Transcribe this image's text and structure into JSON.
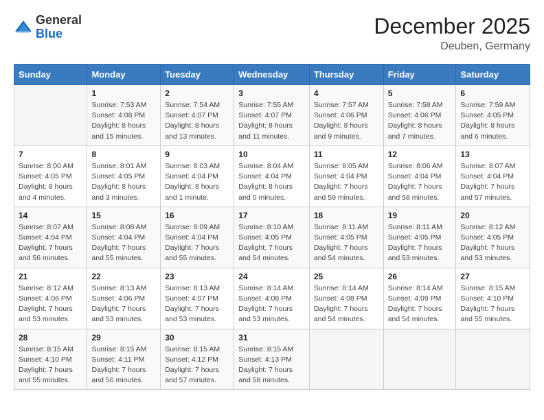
{
  "header": {
    "logo_general": "General",
    "logo_blue": "Blue",
    "month_title": "December 2025",
    "location": "Deuben, Germany"
  },
  "weekdays": [
    "Sunday",
    "Monday",
    "Tuesday",
    "Wednesday",
    "Thursday",
    "Friday",
    "Saturday"
  ],
  "weeks": [
    [
      {
        "day": "",
        "info": ""
      },
      {
        "day": "1",
        "info": "Sunrise: 7:53 AM\nSunset: 4:08 PM\nDaylight: 8 hours\nand 15 minutes."
      },
      {
        "day": "2",
        "info": "Sunrise: 7:54 AM\nSunset: 4:07 PM\nDaylight: 8 hours\nand 13 minutes."
      },
      {
        "day": "3",
        "info": "Sunrise: 7:55 AM\nSunset: 4:07 PM\nDaylight: 8 hours\nand 11 minutes."
      },
      {
        "day": "4",
        "info": "Sunrise: 7:57 AM\nSunset: 4:06 PM\nDaylight: 8 hours\nand 9 minutes."
      },
      {
        "day": "5",
        "info": "Sunrise: 7:58 AM\nSunset: 4:06 PM\nDaylight: 8 hours\nand 7 minutes."
      },
      {
        "day": "6",
        "info": "Sunrise: 7:59 AM\nSunset: 4:05 PM\nDaylight: 8 hours\nand 6 minutes."
      }
    ],
    [
      {
        "day": "7",
        "info": "Sunrise: 8:00 AM\nSunset: 4:05 PM\nDaylight: 8 hours\nand 4 minutes."
      },
      {
        "day": "8",
        "info": "Sunrise: 8:01 AM\nSunset: 4:05 PM\nDaylight: 8 hours\nand 3 minutes."
      },
      {
        "day": "9",
        "info": "Sunrise: 8:03 AM\nSunset: 4:04 PM\nDaylight: 8 hours\nand 1 minute."
      },
      {
        "day": "10",
        "info": "Sunrise: 8:04 AM\nSunset: 4:04 PM\nDaylight: 8 hours\nand 0 minutes."
      },
      {
        "day": "11",
        "info": "Sunrise: 8:05 AM\nSunset: 4:04 PM\nDaylight: 7 hours\nand 59 minutes."
      },
      {
        "day": "12",
        "info": "Sunrise: 8:06 AM\nSunset: 4:04 PM\nDaylight: 7 hours\nand 58 minutes."
      },
      {
        "day": "13",
        "info": "Sunrise: 8:07 AM\nSunset: 4:04 PM\nDaylight: 7 hours\nand 57 minutes."
      }
    ],
    [
      {
        "day": "14",
        "info": "Sunrise: 8:07 AM\nSunset: 4:04 PM\nDaylight: 7 hours\nand 56 minutes."
      },
      {
        "day": "15",
        "info": "Sunrise: 8:08 AM\nSunset: 4:04 PM\nDaylight: 7 hours\nand 55 minutes."
      },
      {
        "day": "16",
        "info": "Sunrise: 8:09 AM\nSunset: 4:04 PM\nDaylight: 7 hours\nand 55 minutes."
      },
      {
        "day": "17",
        "info": "Sunrise: 8:10 AM\nSunset: 4:05 PM\nDaylight: 7 hours\nand 54 minutes."
      },
      {
        "day": "18",
        "info": "Sunrise: 8:11 AM\nSunset: 4:05 PM\nDaylight: 7 hours\nand 54 minutes."
      },
      {
        "day": "19",
        "info": "Sunrise: 8:11 AM\nSunset: 4:05 PM\nDaylight: 7 hours\nand 53 minutes."
      },
      {
        "day": "20",
        "info": "Sunrise: 8:12 AM\nSunset: 4:05 PM\nDaylight: 7 hours\nand 53 minutes."
      }
    ],
    [
      {
        "day": "21",
        "info": "Sunrise: 8:12 AM\nSunset: 4:06 PM\nDaylight: 7 hours\nand 53 minutes."
      },
      {
        "day": "22",
        "info": "Sunrise: 8:13 AM\nSunset: 4:06 PM\nDaylight: 7 hours\nand 53 minutes."
      },
      {
        "day": "23",
        "info": "Sunrise: 8:13 AM\nSunset: 4:07 PM\nDaylight: 7 hours\nand 53 minutes."
      },
      {
        "day": "24",
        "info": "Sunrise: 8:14 AM\nSunset: 4:08 PM\nDaylight: 7 hours\nand 53 minutes."
      },
      {
        "day": "25",
        "info": "Sunrise: 8:14 AM\nSunset: 4:08 PM\nDaylight: 7 hours\nand 54 minutes."
      },
      {
        "day": "26",
        "info": "Sunrise: 8:14 AM\nSunset: 4:09 PM\nDaylight: 7 hours\nand 54 minutes."
      },
      {
        "day": "27",
        "info": "Sunrise: 8:15 AM\nSunset: 4:10 PM\nDaylight: 7 hours\nand 55 minutes."
      }
    ],
    [
      {
        "day": "28",
        "info": "Sunrise: 8:15 AM\nSunset: 4:10 PM\nDaylight: 7 hours\nand 55 minutes."
      },
      {
        "day": "29",
        "info": "Sunrise: 8:15 AM\nSunset: 4:11 PM\nDaylight: 7 hours\nand 56 minutes."
      },
      {
        "day": "30",
        "info": "Sunrise: 8:15 AM\nSunset: 4:12 PM\nDaylight: 7 hours\nand 57 minutes."
      },
      {
        "day": "31",
        "info": "Sunrise: 8:15 AM\nSunset: 4:13 PM\nDaylight: 7 hours\nand 58 minutes."
      },
      {
        "day": "",
        "info": ""
      },
      {
        "day": "",
        "info": ""
      },
      {
        "day": "",
        "info": ""
      }
    ]
  ]
}
